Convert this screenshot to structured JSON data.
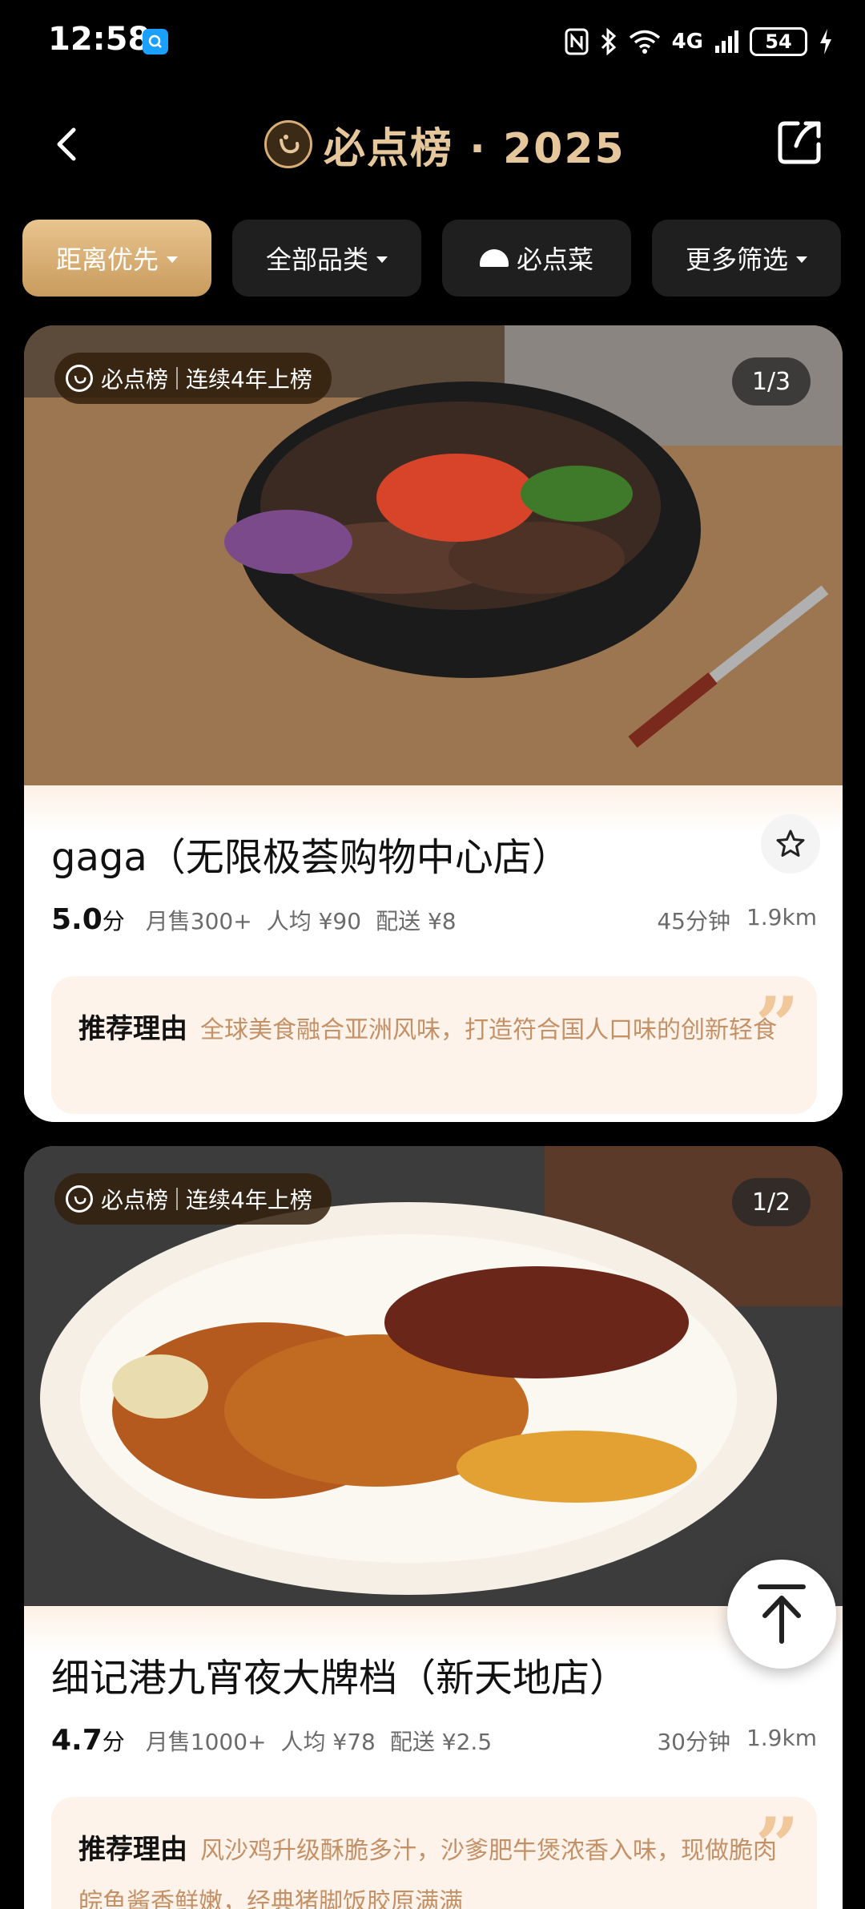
{
  "status_bar": {
    "time": "12:58",
    "network": "4G",
    "battery": "54"
  },
  "header": {
    "title": "必点榜 · 2025"
  },
  "filters": [
    {
      "label": "距离优先",
      "active": true
    },
    {
      "label": "全部品类",
      "active": false
    },
    {
      "label": "必点菜",
      "active": false
    },
    {
      "label": "更多筛选",
      "active": false
    }
  ],
  "cards": [
    {
      "badge_brand": "必点榜",
      "badge_text": "连续4年上榜",
      "photo_counter": "1/3",
      "name": "gaga（无限极荟购物中心店）",
      "score": "5.0",
      "score_unit": "分",
      "monthly_sales": "月售300+",
      "avg_price": "人均 ¥90",
      "delivery_fee": "配送 ¥8",
      "delivery_time": "45分钟",
      "distance": "1.9km",
      "reason_label": "推荐理由",
      "reason_text": "全球美食融合亚洲风味，打造符合国人口味的创新轻食"
    },
    {
      "badge_brand": "必点榜",
      "badge_text": "连续4年上榜",
      "photo_counter": "1/2",
      "name": "细记港九宵夜大牌档（新天地店）",
      "score": "4.7",
      "score_unit": "分",
      "monthly_sales": "月售1000+",
      "avg_price": "人均 ¥78",
      "delivery_fee": "配送 ¥2.5",
      "delivery_time": "30分钟",
      "distance": "1.9km",
      "reason_label": "推荐理由",
      "reason_text": "风沙鸡升级酥脆多汁，沙爹肥牛煲浓香入味，现做脆肉皖鱼酱香鲜嫩，经典猪脚饭胶原满满"
    }
  ],
  "colors": {
    "accent_gold": "#e6c79b",
    "reason_text": "#c49066",
    "quote_mark": "#f0c89b"
  },
  "icons": {
    "back": "chevron-left-icon",
    "share": "share-icon",
    "favorite": "star-outline-icon",
    "back_to_top": "arrow-up-to-top-icon"
  }
}
